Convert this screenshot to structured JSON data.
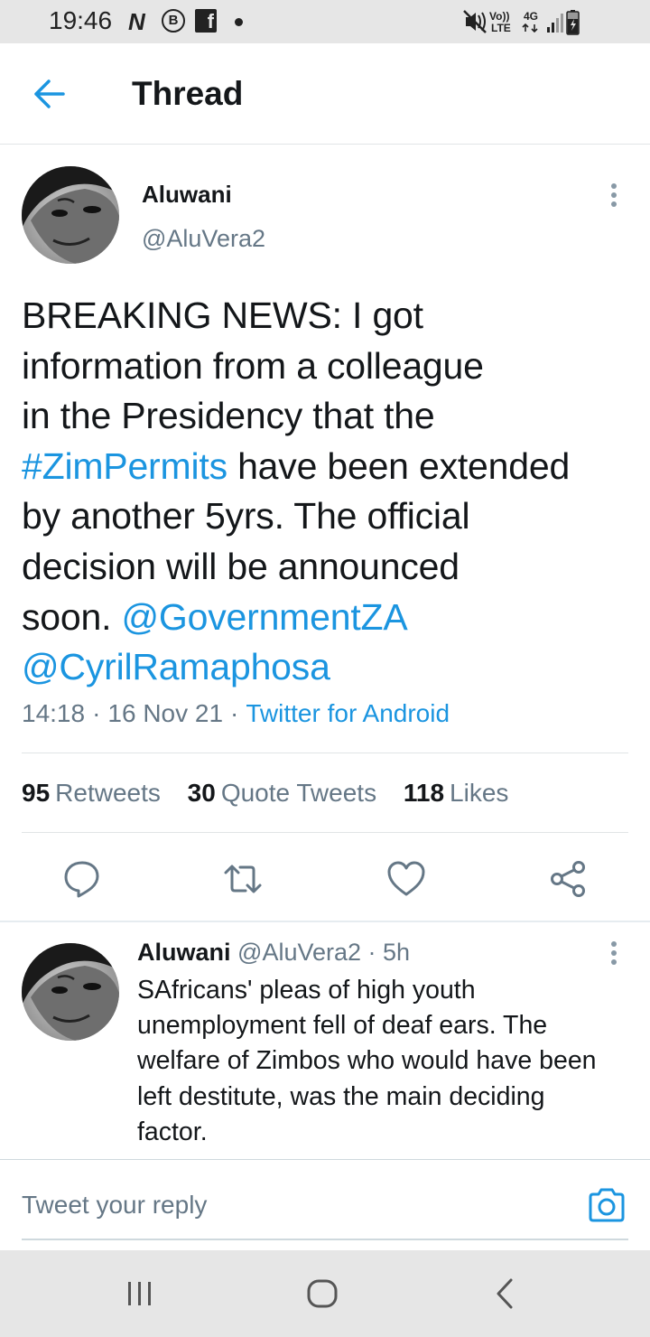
{
  "status_bar": {
    "time": "19:46",
    "left_icons": [
      "n-notification-icon",
      "b-notification-icon",
      "facebook-icon",
      "dot-icon"
    ],
    "volte_label": "Vo))",
    "lte_label": "LTE",
    "network_label": "4G",
    "right_icons": [
      "mute-icon",
      "volte-icon",
      "network-4g-icon",
      "signal-icon",
      "battery-icon"
    ]
  },
  "header": {
    "back_icon": "back-arrow-icon",
    "title": "Thread"
  },
  "tweet": {
    "author_name": "Aluwani",
    "author_handle": "@AluVera2",
    "text_lines": {
      "l1": "BREAKING NEWS: I got",
      "l2": "information from a colleague",
      "l3": "in the Presidency that the",
      "l4_link": "#ZimPermits",
      "l4_rest": " have been extended",
      "l5": "by another 5yrs. The official",
      "l6": "decision will be announced",
      "l7_text": "soon. ",
      "l7_link": "@GovernmentZA",
      "l8_link": "@CyrilRamaphosa"
    },
    "time": "14:18",
    "date": "16 Nov 21",
    "separator": "·",
    "source": "Twitter for Android",
    "stats": {
      "retweets_count": "95",
      "retweets_label": "Retweets",
      "quotes_count": "30",
      "quotes_label": "Quote Tweets",
      "likes_count": "118",
      "likes_label": "Likes"
    },
    "actions": [
      "reply-icon",
      "retweet-icon",
      "like-icon",
      "share-icon"
    ]
  },
  "reply": {
    "author_name": "Aluwani",
    "author_handle": "@AluVera2",
    "meta_sep": " · ",
    "time_ago": "5h",
    "text_lines": {
      "l1": "SAfricans' pleas of high youth",
      "l2": "unemployment fell of deaf ears. The",
      "l3": "welfare of Zimbos who would have been",
      "l4": "left destitute, was the main deciding",
      "l5": "factor."
    }
  },
  "composer": {
    "placeholder": "Tweet your reply",
    "camera_icon": "camera-icon"
  },
  "nav_bar": {
    "buttons": [
      "recents-icon",
      "home-icon",
      "back-icon"
    ]
  },
  "colors": {
    "link": "#1b95e0",
    "secondary_text": "#657786",
    "primary_text": "#14171a",
    "system_bar": "#e6e6e6"
  }
}
